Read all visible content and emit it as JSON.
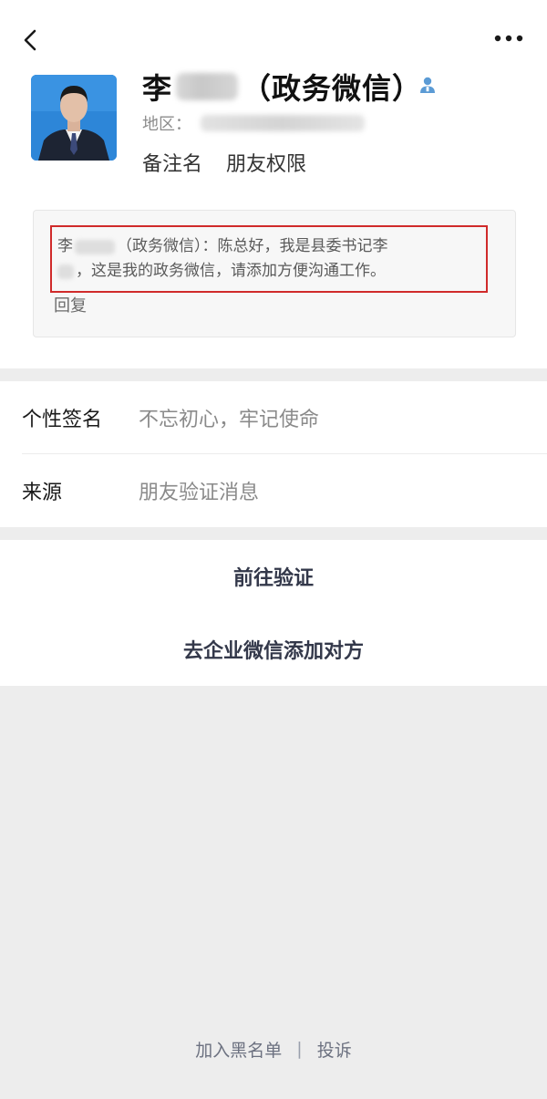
{
  "nav": {
    "back_icon": "chevron-left-icon",
    "more_icon": "more-horizontal-icon"
  },
  "profile": {
    "avatar_icon": "user-avatar-photo",
    "name_prefix": "李",
    "name_suffix": "（政务微信）",
    "contact_icon": "person-contact-icon",
    "region_label": "地区：",
    "remark_label": "备注名",
    "permission_label": "朋友权限"
  },
  "message": {
    "line1_prefix": "李",
    "line1_rest": "（政务微信）：陈总好，我是县委书记李",
    "line2": "，这是我的政务微信，请添加方便沟通工作。",
    "reply_label": "回复",
    "highlight_color": "#d02a2a"
  },
  "info": {
    "signature_label": "个性签名",
    "signature_value": "不忘初心，牢记使命",
    "source_label": "来源",
    "source_value": "朋友验证消息"
  },
  "actions": {
    "verify_label": "前往验证",
    "wecom_label": "去企业微信添加对方"
  },
  "footer": {
    "blacklist_label": "加入黑名单",
    "separator": "|",
    "report_label": "投诉"
  },
  "colors": {
    "background": "#ededed",
    "card": "#ffffff",
    "contact_icon": "#5b9bd5"
  }
}
